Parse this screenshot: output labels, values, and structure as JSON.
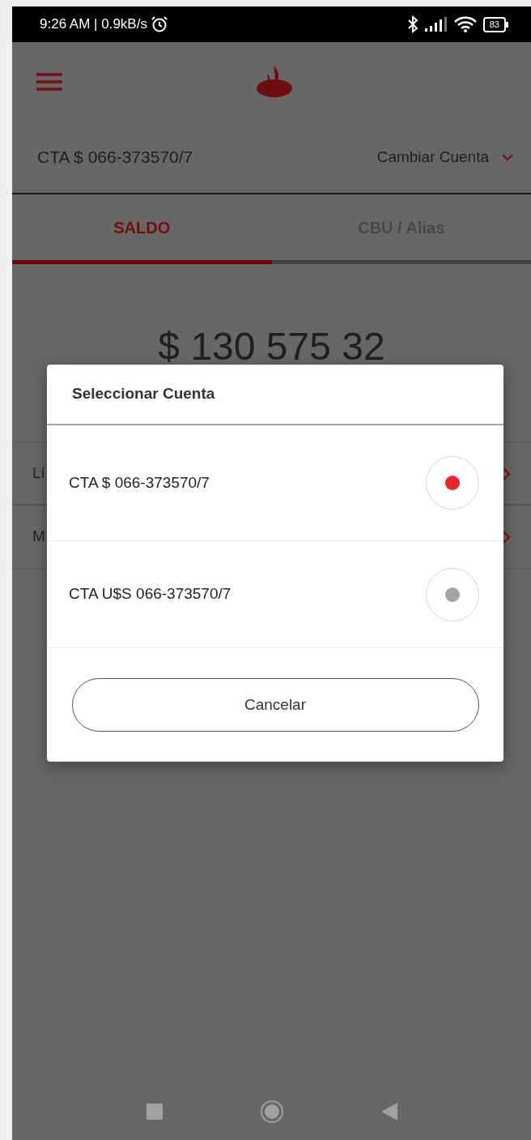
{
  "status_bar": {
    "text": "9:26 AM | 0.9kB/s",
    "battery": "83"
  },
  "account": {
    "label": "CTA $ 066-373570/7",
    "change_link": "Cambiar Cuenta"
  },
  "tabs": [
    {
      "label": "SALDO",
      "selected": true
    },
    {
      "label": "CBU / Alias",
      "selected": false
    }
  ],
  "balance": "$ 130 575 32",
  "rows": [
    {
      "label": "Lí"
    },
    {
      "label": "M"
    }
  ],
  "dialog": {
    "title": "Seleccionar Cuenta",
    "options": [
      {
        "label": "CTA $ 066-373570/7",
        "selected": true
      },
      {
        "label": "CTA U$S 066-373570/7",
        "selected": false
      }
    ],
    "cancel": "Cancelar"
  }
}
